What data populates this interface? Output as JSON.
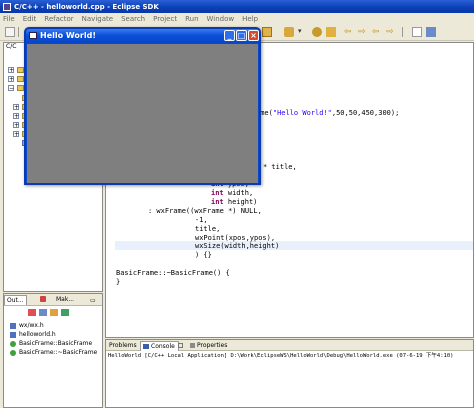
{
  "eclipse": {
    "title": "C/C++ - helloworld.cpp - Eclipse SDK",
    "menu": [
      "File",
      "Edit",
      "Refactor",
      "Navigate",
      "Search",
      "Project",
      "Run",
      "Window",
      "Help"
    ]
  },
  "project_view": {
    "tab_label": "C/C"
  },
  "outline_view": {
    "tabs": [
      "Out...",
      "Mak..."
    ],
    "items": [
      "wx/wx.h",
      "helloworld.h",
      "BasicFrame::BasicFrame",
      "BasicFrame::~BasicFrame"
    ]
  },
  "editor": {
    "lines": [
      {
        "pre": "              ",
        "code": "ame(",
        "str": "\"Hello World!\"",
        "post": ",50,50,450,300);"
      },
      {
        "pre": "",
        "code": "* title,",
        "str": "",
        "post": ""
      },
      {
        "pre": "",
        "code": "int ypos,",
        "str": "",
        "post": ""
      },
      {
        "pre": "",
        "code": "int width,",
        "str": "",
        "post": ""
      },
      {
        "pre": "",
        "code": "int height)",
        "str": "",
        "post": ""
      },
      {
        "pre": "",
        "code": ": wxFrame((wxFrame *) NULL,",
        "str": "",
        "post": ""
      },
      {
        "pre": "",
        "code": "-1,",
        "str": "",
        "post": ""
      },
      {
        "pre": "",
        "code": "title,",
        "str": "",
        "post": ""
      },
      {
        "pre": "",
        "code": "wxPoint(xpos,ypos),",
        "str": "",
        "post": ""
      },
      {
        "pre": "",
        "code": "wxSize(width,height)",
        "str": "",
        "post": ""
      },
      {
        "pre": "",
        "code": ") {}",
        "str": "",
        "post": ""
      },
      {
        "pre": "",
        "code": "BasicFrame::~BasicFrame() {",
        "str": "",
        "post": ""
      },
      {
        "pre": "",
        "code": "}",
        "str": "",
        "post": ""
      }
    ]
  },
  "console_view": {
    "tabs": [
      "Problems",
      "Console",
      "Properties"
    ],
    "text": "HelloWorld [C/C++ Local Application] D:\\Work\\EclipseWS\\HelloWorld\\Debug\\HelloWorld.exe (07-6-19 下午4:10)"
  },
  "wx_window": {
    "title": "Hello World!",
    "client_color": "#7f7f7f"
  },
  "colors": {
    "titlebar": "#0a48d0",
    "keyword": "#7f0055",
    "string": "#2a00ff"
  }
}
